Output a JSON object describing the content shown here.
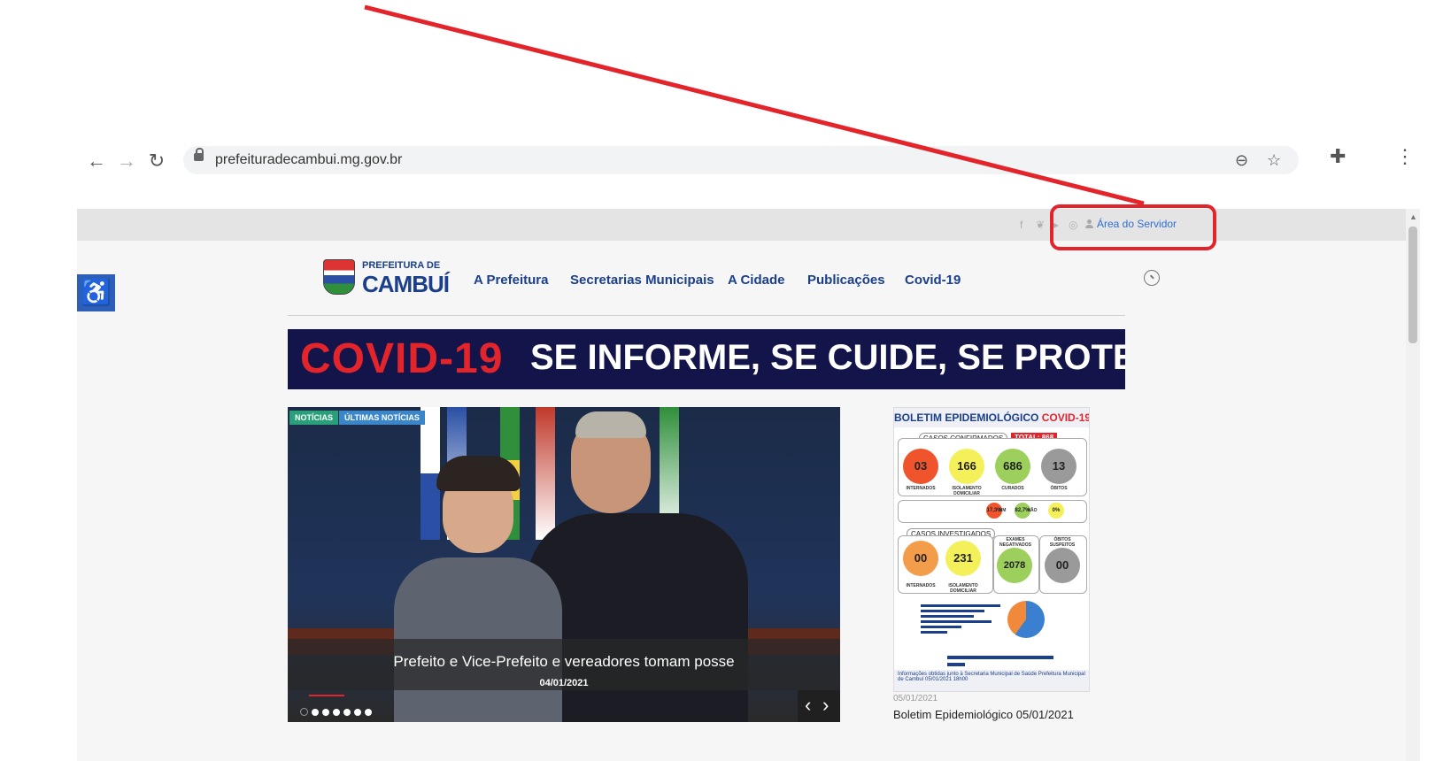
{
  "browser": {
    "url": "prefeituradecambui.mg.gov.br"
  },
  "topbar": {
    "servidor_label": "Área do Servidor"
  },
  "header": {
    "logo_line1": "PREFEITURA DE",
    "logo_line2": "CAMBUÍ",
    "menu": [
      {
        "label": "A Prefeitura"
      },
      {
        "label": "Secretarias Municipais"
      },
      {
        "label": "A Cidade"
      },
      {
        "label": "Publicações"
      },
      {
        "label": "Covid-19"
      }
    ]
  },
  "banner": {
    "covid": "COVID-19",
    "slogan": "SE INFORME, SE CUIDE, SE PROTEJA"
  },
  "slider": {
    "tags": [
      "NOTÍCIAS",
      "ÚLTIMAS NOTÍCIAS"
    ],
    "title": "Prefeito e Vice-Prefeito e vereadores tomam posse",
    "date": "04/01/2021"
  },
  "boletim": {
    "title_a": "BOLETIM EPIDEMIOLÓGICO",
    "title_b": "COVID-19",
    "confirmed_label": "CASOS CONFIRMADOS",
    "total": "TOTAL: 868",
    "stats": [
      {
        "value": "03",
        "label": "INTERNADOS"
      },
      {
        "value": "166",
        "label": "ISOLAMENTO DOMICILIAR"
      },
      {
        "value": "686",
        "label": "CURADOS"
      },
      {
        "value": "13",
        "label": "ÓBITOS"
      }
    ],
    "invest_label": "CASOS INVESTIGADOS",
    "invest": [
      {
        "value": "00",
        "label": "INTERNADOS"
      },
      {
        "value": "231",
        "label": "ISOLAMENTO DOMICILIAR"
      },
      {
        "value": "2078",
        "label": "EXAMES NEGATIVADOS"
      },
      {
        "value": "00",
        "label": "ÓBITOS SUSPEITOS"
      }
    ],
    "comorb": [
      "17,3%",
      "SIM",
      "82,7%",
      "NÃO",
      "0%"
    ],
    "footer": "Informações obtidas junto à Secretaria Municipal de Saúde   Prefeitura Municipal de Cambuí   05/01/2021 18h00",
    "date": "05/01/2021",
    "caption": "Boletim Epidemiológico 05/01/2021"
  },
  "colors": {
    "brand_blue": "#1b3f8b",
    "annotation_red": "#e3242b"
  }
}
